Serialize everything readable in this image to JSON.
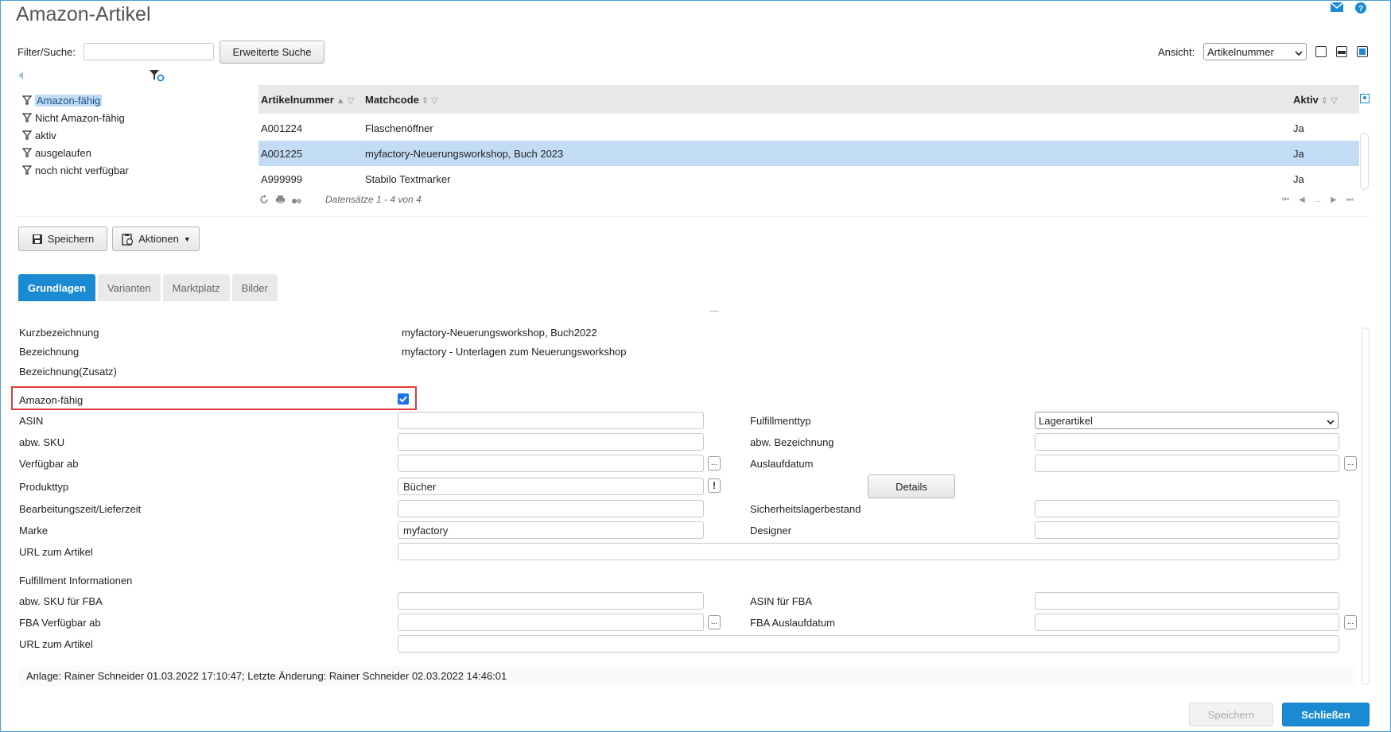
{
  "window": {
    "title": "Amazon-Artikel"
  },
  "topbar": {
    "mail_icon": "mail-icon",
    "help_icon": "help-icon"
  },
  "search": {
    "label": "Filter/Suche:",
    "value": "",
    "advanced_label": "Erweiterte Suche"
  },
  "view": {
    "label": "Ansicht:",
    "selected": "Artikelnummer"
  },
  "filters": [
    {
      "label": "Amazon-fähig",
      "selected": true
    },
    {
      "label": "Nicht Amazon-fähig"
    },
    {
      "label": "aktiv"
    },
    {
      "label": "ausgelaufen"
    },
    {
      "label": "noch nicht verfügbar"
    }
  ],
  "grid": {
    "columns": [
      "Artikelnummer",
      "Matchcode",
      "Aktiv"
    ],
    "rows": [
      {
        "artikelnummer": "A001224",
        "matchcode": "Flaschenöffner",
        "aktiv": "Ja"
      },
      {
        "artikelnummer": "A001225",
        "matchcode": "myfactory-Neuerungsworkshop, Buch 2023",
        "aktiv": "Ja",
        "selected": true
      },
      {
        "artikelnummer": "A999999",
        "matchcode": "Stabilo Textmarker",
        "aktiv": "Ja"
      }
    ],
    "footer": "Datensätze 1 - 4 von 4",
    "pager_ellipsis": "..."
  },
  "toolbar": {
    "save_label": "Speichern",
    "actions_label": "Aktionen"
  },
  "tabs": [
    {
      "label": "Grundlagen",
      "active": true
    },
    {
      "label": "Varianten"
    },
    {
      "label": "Marktplatz"
    },
    {
      "label": "Bilder"
    }
  ],
  "form": {
    "kurzbezeichnung": {
      "label": "Kurzbezeichnung",
      "value": "myfactory-Neuerungsworkshop, Buch2022"
    },
    "bezeichnung": {
      "label": "Bezeichnung",
      "value": "myfactory - Unterlagen zum Neuerungsworkshop"
    },
    "bezeichnung_zusatz": {
      "label": "Bezeichnung(Zusatz)"
    },
    "amazon_faehig": {
      "label": "Amazon-fähig",
      "checked": true
    },
    "asin": {
      "label": "ASIN",
      "value": ""
    },
    "abw_sku": {
      "label": "abw. SKU",
      "value": ""
    },
    "verfuegbar_ab": {
      "label": "Verfügbar ab",
      "value": ""
    },
    "produkttyp": {
      "label": "Produkttyp",
      "value": "Bücher"
    },
    "bearbeitungszeit": {
      "label": "Bearbeitungszeit/Lieferzeit",
      "value": ""
    },
    "marke": {
      "label": "Marke",
      "value": "myfactory"
    },
    "url": {
      "label": "URL zum Artikel",
      "value": ""
    },
    "fulfillmenttyp": {
      "label": "Fulfillmenttyp",
      "value": "Lagerartikel"
    },
    "abw_bezeichnung": {
      "label": "abw. Bezeichnung",
      "value": ""
    },
    "auslaufdatum": {
      "label": "Auslaufdatum",
      "value": ""
    },
    "details_label": "Details",
    "sicherheitslagerbestand": {
      "label": "Sicherheitslagerbestand",
      "value": ""
    },
    "designer": {
      "label": "Designer",
      "value": ""
    },
    "fulfillment_section": "Fulfillment Informationen",
    "abw_sku_fba": {
      "label": "abw. SKU für FBA",
      "value": ""
    },
    "fba_verfuegbar_ab": {
      "label": "FBA Verfügbar ab",
      "value": ""
    },
    "fba_url": {
      "label": "URL zum Artikel",
      "value": ""
    },
    "asin_fba": {
      "label": "ASIN für FBA",
      "value": ""
    },
    "fba_auslaufdatum": {
      "label": "FBA Auslaufdatum",
      "value": ""
    },
    "dots": "...",
    "excl": "!"
  },
  "status": {
    "text": "Anlage: Rainer Schneider 01.03.2022 17:10:47; Letzte Änderung: Rainer Schneider 02.03.2022 14:46:01"
  },
  "footer": {
    "save_label": "Speichern",
    "close_label": "Schließen"
  },
  "colors": {
    "accent": "#1a8ad2",
    "highlight_border": "#e03a3a",
    "selected_row": "#c3dcf5"
  }
}
